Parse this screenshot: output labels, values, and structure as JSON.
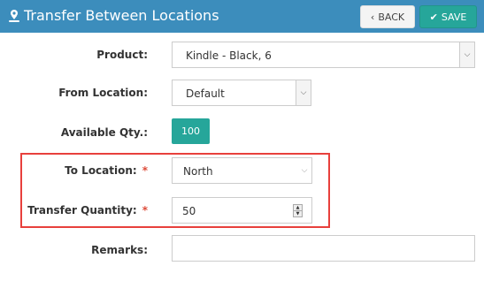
{
  "header": {
    "title": "Transfer Between Locations",
    "icon": "location-pin-icon",
    "back_label": "BACK",
    "save_label": "SAVE",
    "back_icon": "chevron-left-icon",
    "save_icon": "check-icon"
  },
  "form": {
    "product": {
      "label": "Product:",
      "value": "Kindle - Black, 6"
    },
    "from_location": {
      "label": "From Location:",
      "value": "Default"
    },
    "available_qty": {
      "label": "Available Qty.:",
      "value": "100"
    },
    "to_location": {
      "label": "To Location:",
      "required_mark": "*",
      "value": "North"
    },
    "transfer_quantity": {
      "label": "Transfer Quantity:",
      "required_mark": "*",
      "value": "50"
    },
    "remarks": {
      "label": "Remarks:",
      "value": ""
    }
  },
  "colors": {
    "header": "#3c8dbc",
    "accent": "#26a69a",
    "highlight": "#e8403c",
    "required": "#dd4b39"
  }
}
